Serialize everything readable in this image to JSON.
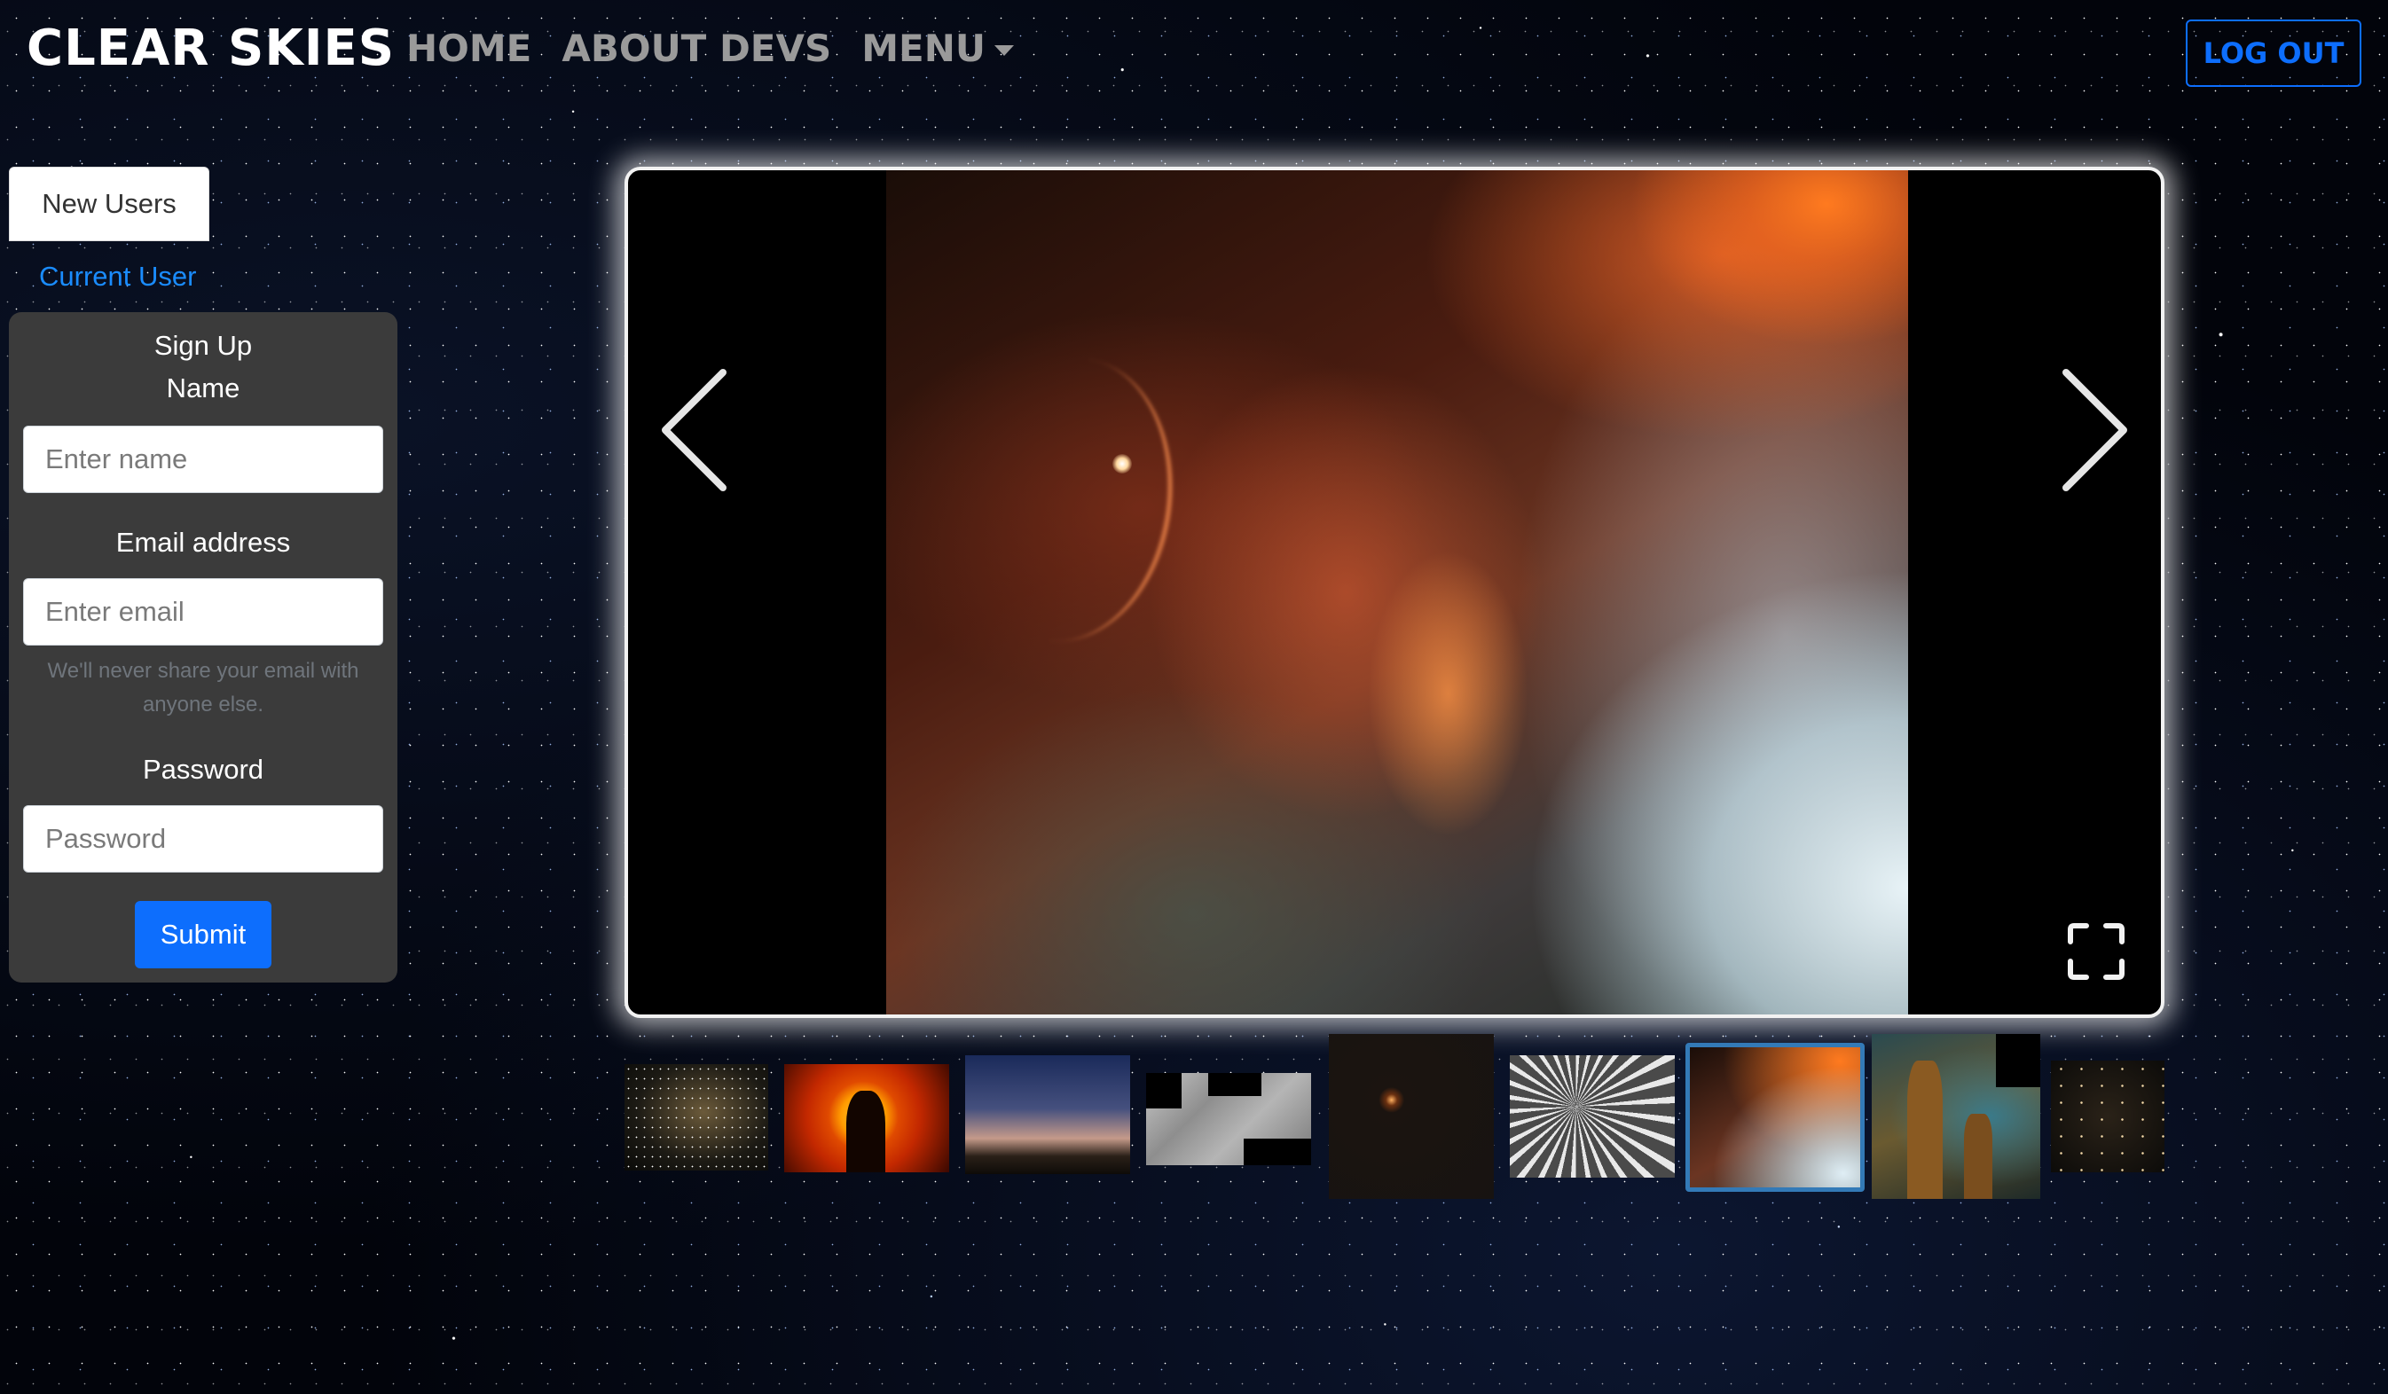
{
  "navbar": {
    "brand": "CLEAR SKIES",
    "links": [
      "HOME",
      "ABOUT DEVS",
      "MENU"
    ],
    "logout_label": "LOG OUT"
  },
  "sidebar": {
    "tab_new_users": "New Users",
    "tab_current_user": "Current User",
    "form": {
      "title": "Sign Up",
      "name_label": "Name",
      "name_placeholder": "Enter name",
      "email_label": "Email address",
      "email_placeholder": "Enter email",
      "email_help": "We'll never share your email with anyone else.",
      "password_label": "Password",
      "password_placeholder": "Password",
      "submit_label": "Submit"
    }
  },
  "gallery": {
    "icons": {
      "prev": "chevron-left-icon",
      "next": "chevron-right-icon",
      "fullscreen": "fullscreen-icon"
    },
    "active_index": 6,
    "thumbnails": [
      {
        "name": "star-cluster-thumbnail"
      },
      {
        "name": "eclipse-palm-thumbnail"
      },
      {
        "name": "twilight-sky-thumbnail"
      },
      {
        "name": "lunar-mosaic-thumbnail"
      },
      {
        "name": "dark-starfield-thumbnail"
      },
      {
        "name": "crater-rays-thumbnail"
      },
      {
        "name": "orange-nebula-thumbnail"
      },
      {
        "name": "pillars-of-creation-thumbnail"
      },
      {
        "name": "galaxy-field-thumbnail"
      }
    ]
  },
  "colors": {
    "accent_blue": "#0d6efd",
    "link_blue": "#1a8cff",
    "active_thumb_border": "#337ab7",
    "form_bg": "#3b3b3b",
    "nav_gray": "#9a9a9a"
  }
}
